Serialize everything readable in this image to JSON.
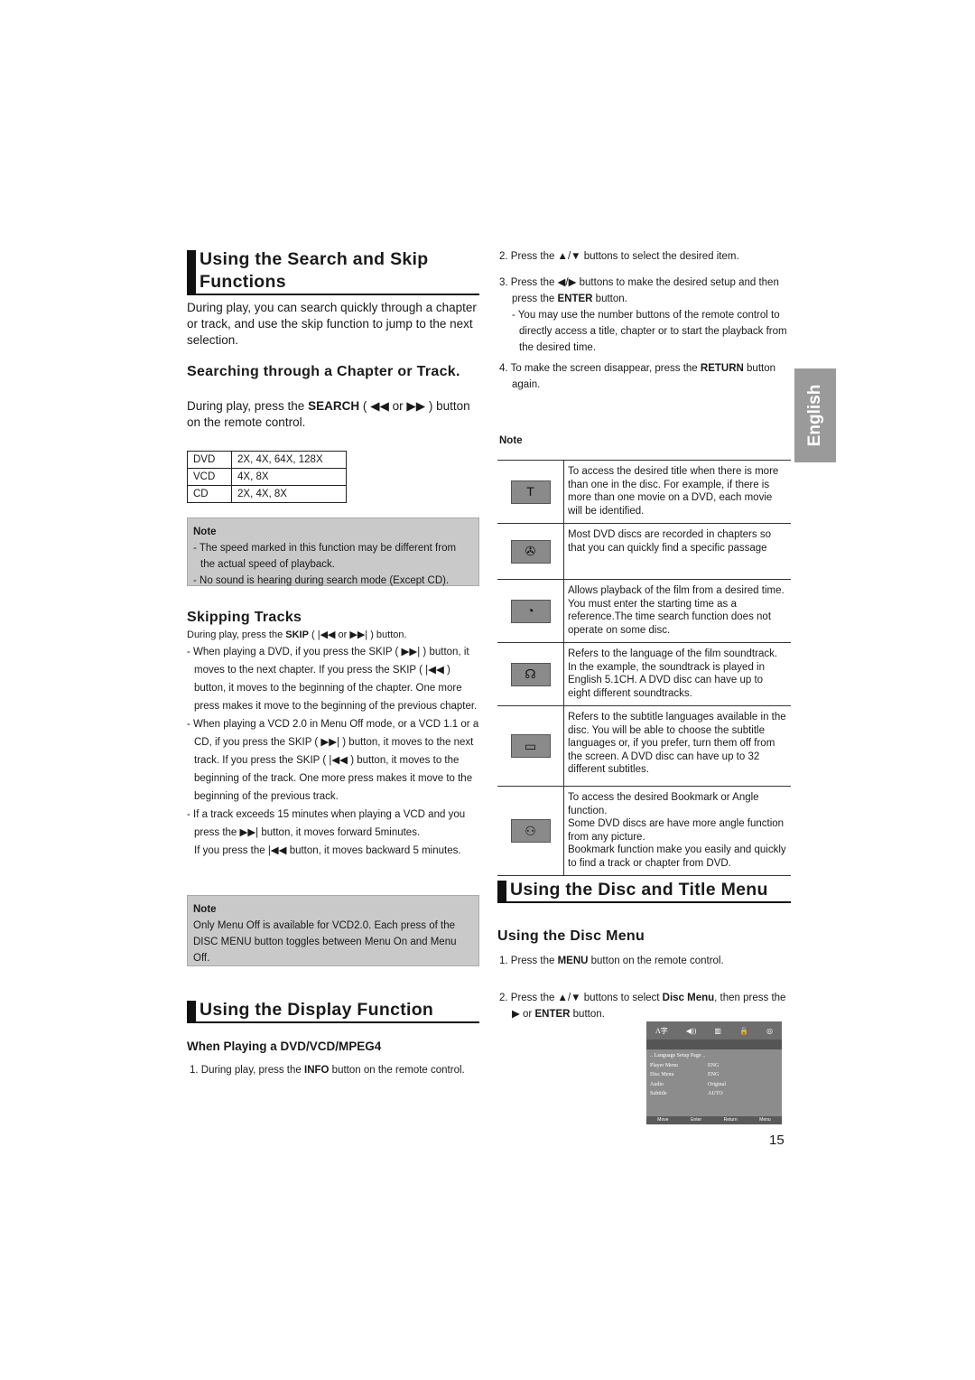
{
  "language_tab": "English",
  "page_number": "15",
  "left": {
    "search_heading": "Using the Search and Skip Functions",
    "search_intro": "During play, you can search quickly through a chapter or track, and use the skip function to jump to the next selection.",
    "chapter_heading": "Searching through a Chapter or Track.",
    "chapter_text_pre": "During play, press the ",
    "chapter_text_bold": "SEARCH",
    "chapter_text_post": " ( ◀◀ or ▶▶ ) button on the remote control.",
    "speed_table": [
      [
        "DVD",
        "2X, 4X, 64X, 128X"
      ],
      [
        "VCD",
        "4X, 8X"
      ],
      [
        "CD",
        "2X, 4X, 8X"
      ]
    ],
    "note1_title": "Note",
    "note1_items": [
      "- The speed marked in this function may be different from the actual speed of playback.",
      "- No sound is hearing during search mode (Except CD)."
    ],
    "skip_heading": "Skipping Tracks",
    "skip_intro_pre": "During play, press the ",
    "skip_intro_bold": "SKIP",
    "skip_intro_post": " ( |◀◀ or ▶▶| ) button.",
    "skip_items": [
      "- When playing a DVD, if you press the SKIP ( ▶▶| ) button, it moves to the next chapter. If you press the SKIP ( |◀◀ ) button, it moves to the beginning of the chapter. One more press makes it move to the beginning of the previous chapter.",
      "- When playing a VCD 2.0 in Menu Off mode, or a VCD 1.1 or a CD, if you press the SKIP ( ▶▶| ) button, it moves to the next track. If you press the SKIP ( |◀◀ ) button, it moves to the beginning of the track. One more press makes it move to the beginning of the previous track.",
      "- If a track exceeds 15 minutes when playing a VCD and you press the ▶▶| button, it moves forward 5minutes.",
      "If you press the |◀◀ button, it moves backward 5 minutes."
    ],
    "note2_title": "Note",
    "note2_text": "Only Menu Off is available for VCD2.0. Each press of the DISC MENU button toggles between Menu On and Menu Off.",
    "display_heading": "Using the Display Function",
    "display_sub": "When Playing a DVD/VCD/MPEG4",
    "display_step_pre": "1. During play, press the ",
    "display_step_bold": "INFO",
    "display_step_post": " button on the remote control."
  },
  "right": {
    "step2": "2. Press the ▲/▼ buttons to select the desired item.",
    "step3_pre": "3. Press the ◀/▶ buttons to make the desired setup and then press the ",
    "step3_bold": "ENTER",
    "step3_post": " button.",
    "step3_sub": "- You may use the number buttons of the remote control to directly access a title, chapter or to start the playback from the desired time.",
    "step4_pre": "4. To make the screen disappear, press the ",
    "step4_bold": "RETURN",
    "step4_post": " button again.",
    "note_title": "Note",
    "icon_rows": [
      {
        "icon": "title-icon",
        "glyph": "T",
        "text": "To access the desired title when there is more than one in the disc. For example, if there is more than one movie on a DVD, each movie will be identified."
      },
      {
        "icon": "chapter-icon",
        "glyph": "✇",
        "text": "Most DVD discs are recorded in chapters so that you can quickly find a specific passage"
      },
      {
        "icon": "time-icon",
        "glyph": "◔",
        "text": "Allows playback of the film from a desired time. You must enter the starting time as a reference.The time search function does not operate on some disc."
      },
      {
        "icon": "audio-icon",
        "glyph": "☊",
        "text": "Refers to the language of the film soundtrack. In the example, the soundtrack is played in English 5.1CH. A DVD disc can have up to eight different soundtracks."
      },
      {
        "icon": "subtitle-icon",
        "glyph": "▭",
        "text": "Refers to the subtitle languages available in the disc. You will be able to choose the subtitle languages or, if you prefer, turn them off from the screen. A DVD disc can have up to 32 different subtitles."
      },
      {
        "icon": "bookmark-angle-icon",
        "glyph": "⚇",
        "text": "To access the desired Bookmark or Angle function.\nSome DVD discs are have more angle function from any picture.\nBookmark function make you easily and quickly to find a track or chapter from DVD."
      }
    ],
    "disc_heading": "Using the Disc and Title Menu",
    "disc_sub": "Using the Disc Menu",
    "disc_step1_pre": "1. Press the ",
    "disc_step1_bold": "MENU",
    "disc_step1_post": " button on the remote  control.",
    "disc_step2_pre": "2. Press the ▲/▼ buttons to select ",
    "disc_step2_bold": "Disc Menu",
    "disc_step2_mid": ", then press the ▶ or ",
    "disc_step2_bold2": "ENTER",
    "disc_step2_post": " button.",
    "screen": {
      "title": ".. Language Setup Page ..",
      "rows": [
        [
          "Player Menu",
          "ENG"
        ],
        [
          "Disc Menu",
          "ENG"
        ],
        [
          "Audio",
          "Original"
        ],
        [
          "Subtitle",
          "AUTO"
        ]
      ],
      "footer": [
        "Move",
        "Enter",
        "Return",
        "Menu"
      ]
    }
  }
}
